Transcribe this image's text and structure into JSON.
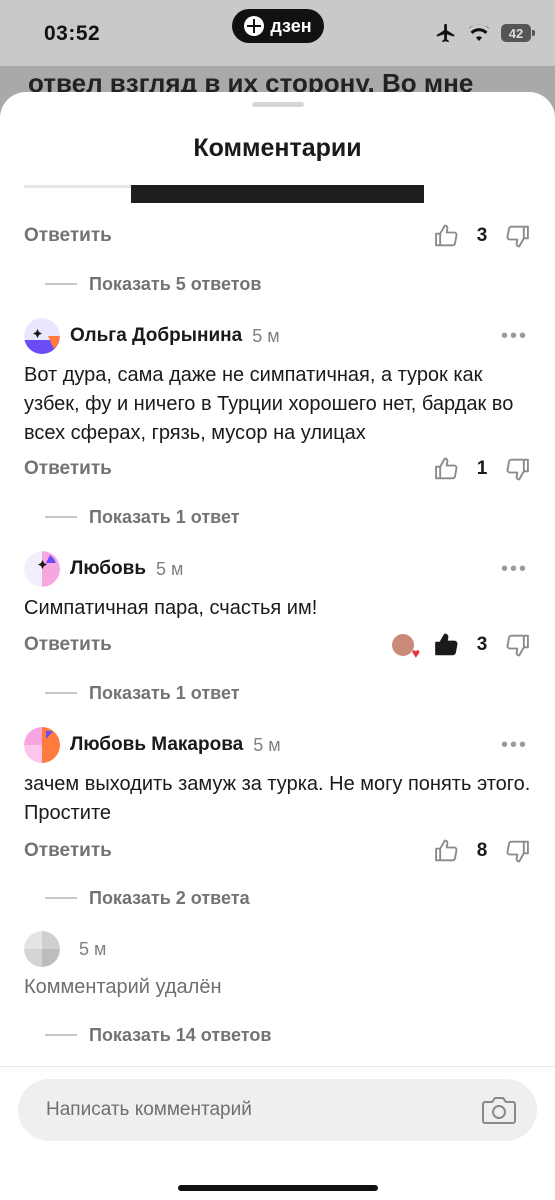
{
  "status_bar": {
    "time": "03:52",
    "app_badge": "дзен",
    "battery": "42"
  },
  "background": {
    "article_fragment": "отвел взгляд в их сторону. Во мне"
  },
  "sheet": {
    "title": "Комментарии"
  },
  "labels": {
    "reply": "Ответить"
  },
  "threads": [
    {
      "likes": "3",
      "show_replies": "Показать 5 ответов"
    },
    {
      "author": "Ольга Добрынина",
      "ago": "5 м",
      "text": "Вот дура, сама даже не симпатичная, а турок как узбек, фу и ничего в Турции хорошего нет, бардак во всех сферах, грязь, мусор на улицах",
      "likes": "1",
      "show_replies": "Показать 1 ответ"
    },
    {
      "author": "Любовь",
      "ago": "5 м",
      "text": "Симпатичная пара, счастья им!",
      "likes": "3",
      "show_replies": "Показать 1 ответ"
    },
    {
      "author": "Любовь Макарова",
      "ago": "5 м",
      "text": "зачем выходить замуж за турка. Не могу понять этого. Простите",
      "likes": "8",
      "show_replies": "Показать 2 ответа"
    },
    {
      "ago": "5 м",
      "text": "Комментарий удалён",
      "show_replies": "Показать 14 ответов"
    }
  ],
  "composer": {
    "placeholder": "Написать комментарий"
  },
  "colors": {
    "accent_purple": "#6b4cf6",
    "accent_orange": "#ff7a3d",
    "accent_pink": "#f7a6e0",
    "text_muted": "#737373"
  },
  "icons": [
    "airplane-icon",
    "wifi-icon",
    "battery-icon",
    "thumb-up-icon",
    "thumb-down-icon",
    "more-icon",
    "camera-icon"
  ]
}
